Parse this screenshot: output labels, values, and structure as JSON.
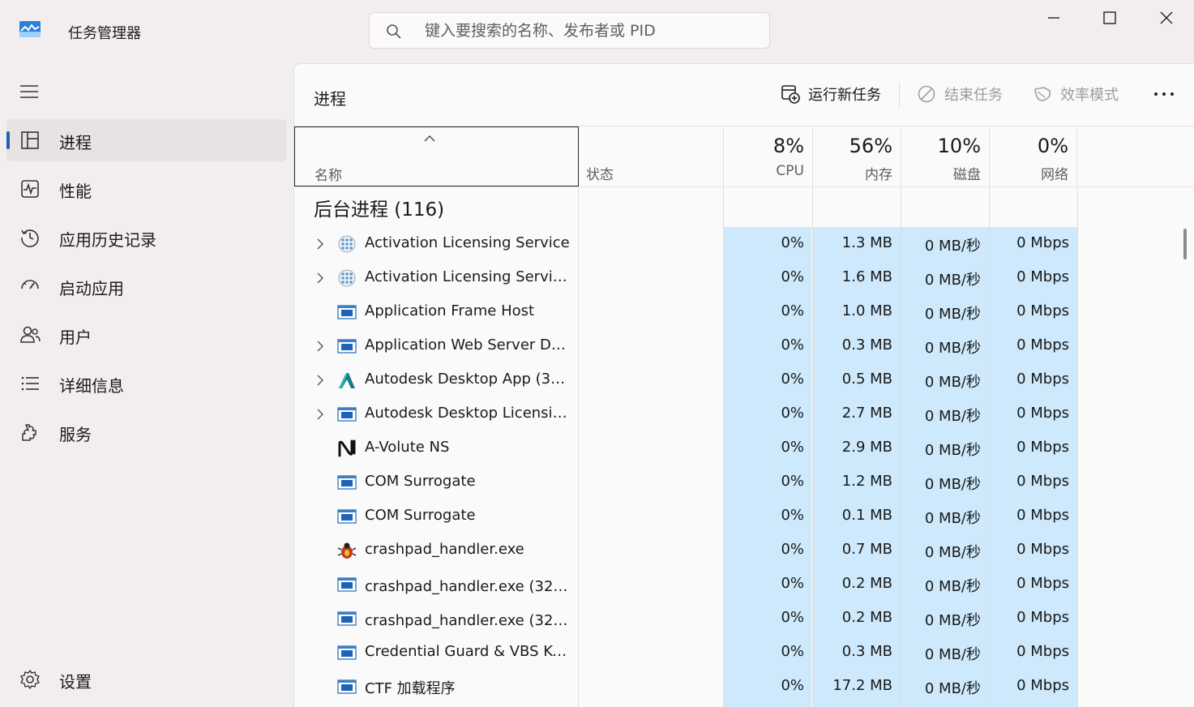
{
  "app": {
    "title": "任务管理器"
  },
  "search": {
    "placeholder": "键入要搜索的名称、发布者或 PID"
  },
  "sidebar": {
    "items": [
      {
        "label": "进程",
        "icon": "processes-icon",
        "active": true
      },
      {
        "label": "性能",
        "icon": "performance-icon"
      },
      {
        "label": "应用历史记录",
        "icon": "app-history-icon"
      },
      {
        "label": "启动应用",
        "icon": "startup-apps-icon"
      },
      {
        "label": "用户",
        "icon": "users-icon"
      },
      {
        "label": "详细信息",
        "icon": "details-icon"
      },
      {
        "label": "服务",
        "icon": "services-icon"
      }
    ],
    "settings_label": "设置"
  },
  "main": {
    "title": "进程",
    "toolbar": {
      "run_new_task": "运行新任务",
      "end_task": "结束任务",
      "efficiency_mode": "效率模式"
    },
    "columns": {
      "name": "名称",
      "status": "状态",
      "cpu": {
        "pct": "8%",
        "label": "CPU"
      },
      "memory": {
        "pct": "56%",
        "label": "内存"
      },
      "disk": {
        "pct": "10%",
        "label": "磁盘"
      },
      "network": {
        "pct": "0%",
        "label": "网络"
      }
    },
    "section_title": "后台进程 (116)",
    "rows": [
      {
        "name": "Activation Licensing Service",
        "expandable": true,
        "icon": "service-grid-icon",
        "cpu": "0%",
        "mem": "1.3 MB",
        "disk": "0 MB/秒",
        "net": "0 Mbps"
      },
      {
        "name": "Activation Licensing Service...",
        "expandable": true,
        "icon": "service-grid-icon",
        "cpu": "0%",
        "mem": "1.6 MB",
        "disk": "0 MB/秒",
        "net": "0 Mbps"
      },
      {
        "name": "Application Frame Host",
        "expandable": false,
        "icon": "window-app-icon",
        "cpu": "0%",
        "mem": "1.0 MB",
        "disk": "0 MB/秒",
        "net": "0 Mbps"
      },
      {
        "name": "Application Web Server Da...",
        "expandable": true,
        "icon": "window-app-icon",
        "cpu": "0%",
        "mem": "0.3 MB",
        "disk": "0 MB/秒",
        "net": "0 Mbps"
      },
      {
        "name": "Autodesk Desktop App (32 ...",
        "expandable": true,
        "icon": "autodesk-logo-icon",
        "cpu": "0%",
        "mem": "0.5 MB",
        "disk": "0 MB/秒",
        "net": "0 Mbps"
      },
      {
        "name": "Autodesk Desktop Licensin...",
        "expandable": true,
        "icon": "window-app-icon",
        "cpu": "0%",
        "mem": "2.7 MB",
        "disk": "0 MB/秒",
        "net": "0 Mbps"
      },
      {
        "name": "A-Volute NS",
        "expandable": false,
        "icon": "avolute-logo-icon",
        "cpu": "0%",
        "mem": "2.9 MB",
        "disk": "0 MB/秒",
        "net": "0 Mbps"
      },
      {
        "name": "COM Surrogate",
        "expandable": false,
        "icon": "window-app-icon",
        "cpu": "0%",
        "mem": "1.2 MB",
        "disk": "0 MB/秒",
        "net": "0 Mbps"
      },
      {
        "name": "COM Surrogate",
        "expandable": false,
        "icon": "window-app-icon",
        "cpu": "0%",
        "mem": "0.1 MB",
        "disk": "0 MB/秒",
        "net": "0 Mbps"
      },
      {
        "name": "crashpad_handler.exe",
        "expandable": false,
        "icon": "crashpad-bug-icon",
        "cpu": "0%",
        "mem": "0.7 MB",
        "disk": "0 MB/秒",
        "net": "0 Mbps"
      },
      {
        "name": "crashpad_handler.exe (32 位)",
        "expandable": false,
        "icon": "window-app-icon",
        "cpu": "0%",
        "mem": "0.2 MB",
        "disk": "0 MB/秒",
        "net": "0 Mbps"
      },
      {
        "name": "crashpad_handler.exe (32 位)",
        "expandable": false,
        "icon": "window-app-icon",
        "cpu": "0%",
        "mem": "0.2 MB",
        "disk": "0 MB/秒",
        "net": "0 Mbps"
      },
      {
        "name": "Credential Guard & VBS Ke...",
        "expandable": false,
        "icon": "window-app-icon",
        "cpu": "0%",
        "mem": "0.3 MB",
        "disk": "0 MB/秒",
        "net": "0 Mbps"
      },
      {
        "name": "CTF 加载程序",
        "expandable": false,
        "icon": "window-app-icon",
        "cpu": "0%",
        "mem": "17.2 MB",
        "disk": "0 MB/秒",
        "net": "0 Mbps"
      }
    ]
  },
  "colors": {
    "heat_cell": "#cde9fb",
    "accent": "#1f5fb8"
  }
}
